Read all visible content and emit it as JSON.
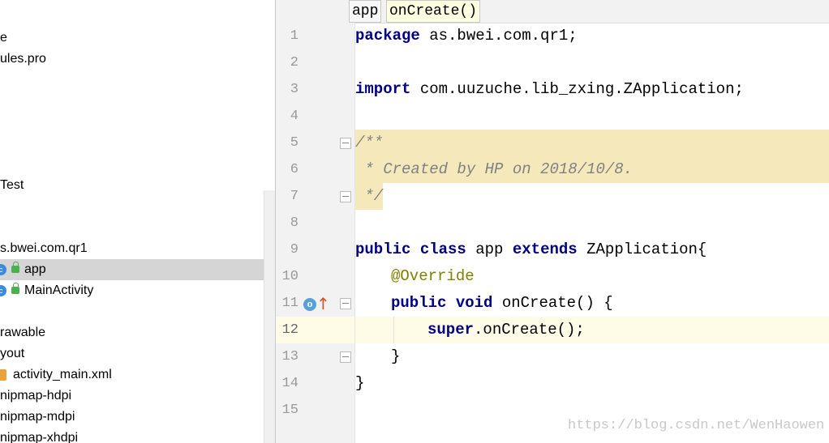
{
  "project_tree": {
    "items": [
      {
        "label": "e"
      },
      {
        "label": "ules.pro"
      },
      {
        "label": "Test"
      },
      {
        "label": "s.bwei.com.qr1"
      },
      {
        "label": "app",
        "icon": "class-icon",
        "selected": true
      },
      {
        "label": "MainActivity",
        "icon": "class-icon"
      },
      {
        "label": "rawable"
      },
      {
        "label": "yout"
      },
      {
        "label": "activity_main.xml",
        "icon": "xml-file-icon"
      },
      {
        "label": "nipmap-hdpi"
      },
      {
        "label": "nipmap-mdpi"
      },
      {
        "label": "nipmap-xhdpi"
      }
    ]
  },
  "breadcrumb": {
    "items": [
      "app",
      "onCreate()"
    ]
  },
  "editor": {
    "line_numbers": [
      "1",
      "2",
      "3",
      "4",
      "5",
      "6",
      "7",
      "8",
      "9",
      "10",
      "11",
      "12",
      "13",
      "14",
      "15"
    ],
    "current_line": "12",
    "lines": {
      "l1_kw": "package",
      "l1_rest": " as.bwei.com.qr1;",
      "l3_kw": "import",
      "l3_rest": " com.uuzuche.lib_zxing.ZApplication;",
      "l5": "/**",
      "l6": " * Created by HP on 2018/10/8.",
      "l7": " */",
      "l9_kw1": "public",
      "l9_kw2": "class",
      "l9_name": "app",
      "l9_kw3": "extends",
      "l9_rest": "ZApplication{",
      "l10": "@Override",
      "l11_kw1": "public",
      "l11_kw2": "void",
      "l11_rest": "onCreate() {",
      "l12_kw": "super",
      "l12_rest": ".onCreate();",
      "l13": "}",
      "l14": "}"
    },
    "gutter_icons": [
      "override-icon",
      "up-arrow-icon"
    ]
  },
  "watermark": "https://blog.csdn.net/WenHaowen",
  "colors": {
    "keyword": "#000080",
    "doc_comment": "#808080",
    "annotation": "#808000",
    "doc_highlight": "#f5e9bc",
    "current_line": "#fefce6",
    "selection": "#d5d5d5"
  }
}
